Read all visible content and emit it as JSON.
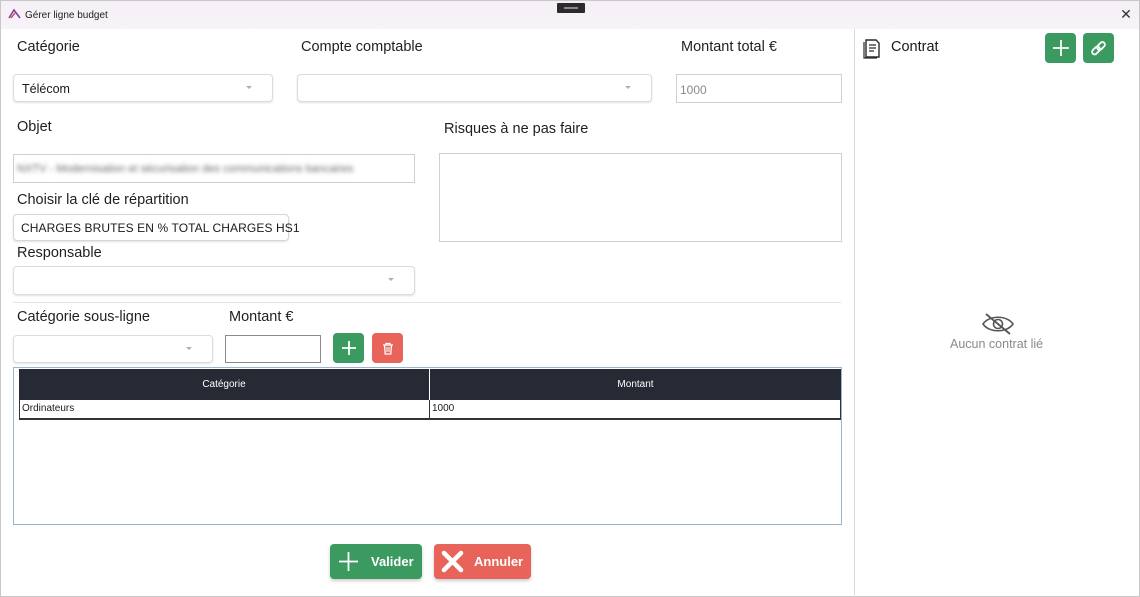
{
  "window": {
    "title": "Gérer ligne budget"
  },
  "form": {
    "categorie_label": "Catégorie",
    "categorie_value": "Télécom",
    "compte_label": "Compte comptable",
    "compte_value": "",
    "montant_total_label": "Montant total €",
    "montant_total_value": "1000",
    "objet_label": "Objet",
    "objet_value": "NXTV - Modernisation et sécurisation des communications bancaires",
    "risques_label": "Risques à ne pas faire",
    "risques_value": "",
    "cle_label": "Choisir la clé de répartition",
    "cle_value": "CHARGES BRUTES EN % TOTAL CHARGES HS1",
    "responsable_label": "Responsable",
    "responsable_value": ""
  },
  "subline": {
    "categorie_label": "Catégorie sous-ligne",
    "montant_label": "Montant €",
    "montant_value": ""
  },
  "grid": {
    "headers": [
      "Catégorie",
      "Montant"
    ],
    "rows": [
      {
        "categorie": "Ordinateurs",
        "montant": "1000"
      }
    ]
  },
  "actions": {
    "valider": "Valider",
    "annuler": "Annuler"
  },
  "contrat": {
    "title": "Contrat",
    "empty": "Aucun contrat lié"
  },
  "colors": {
    "green": "#3a9a5f",
    "red": "#e8645a",
    "grid_header": "#262a35"
  }
}
